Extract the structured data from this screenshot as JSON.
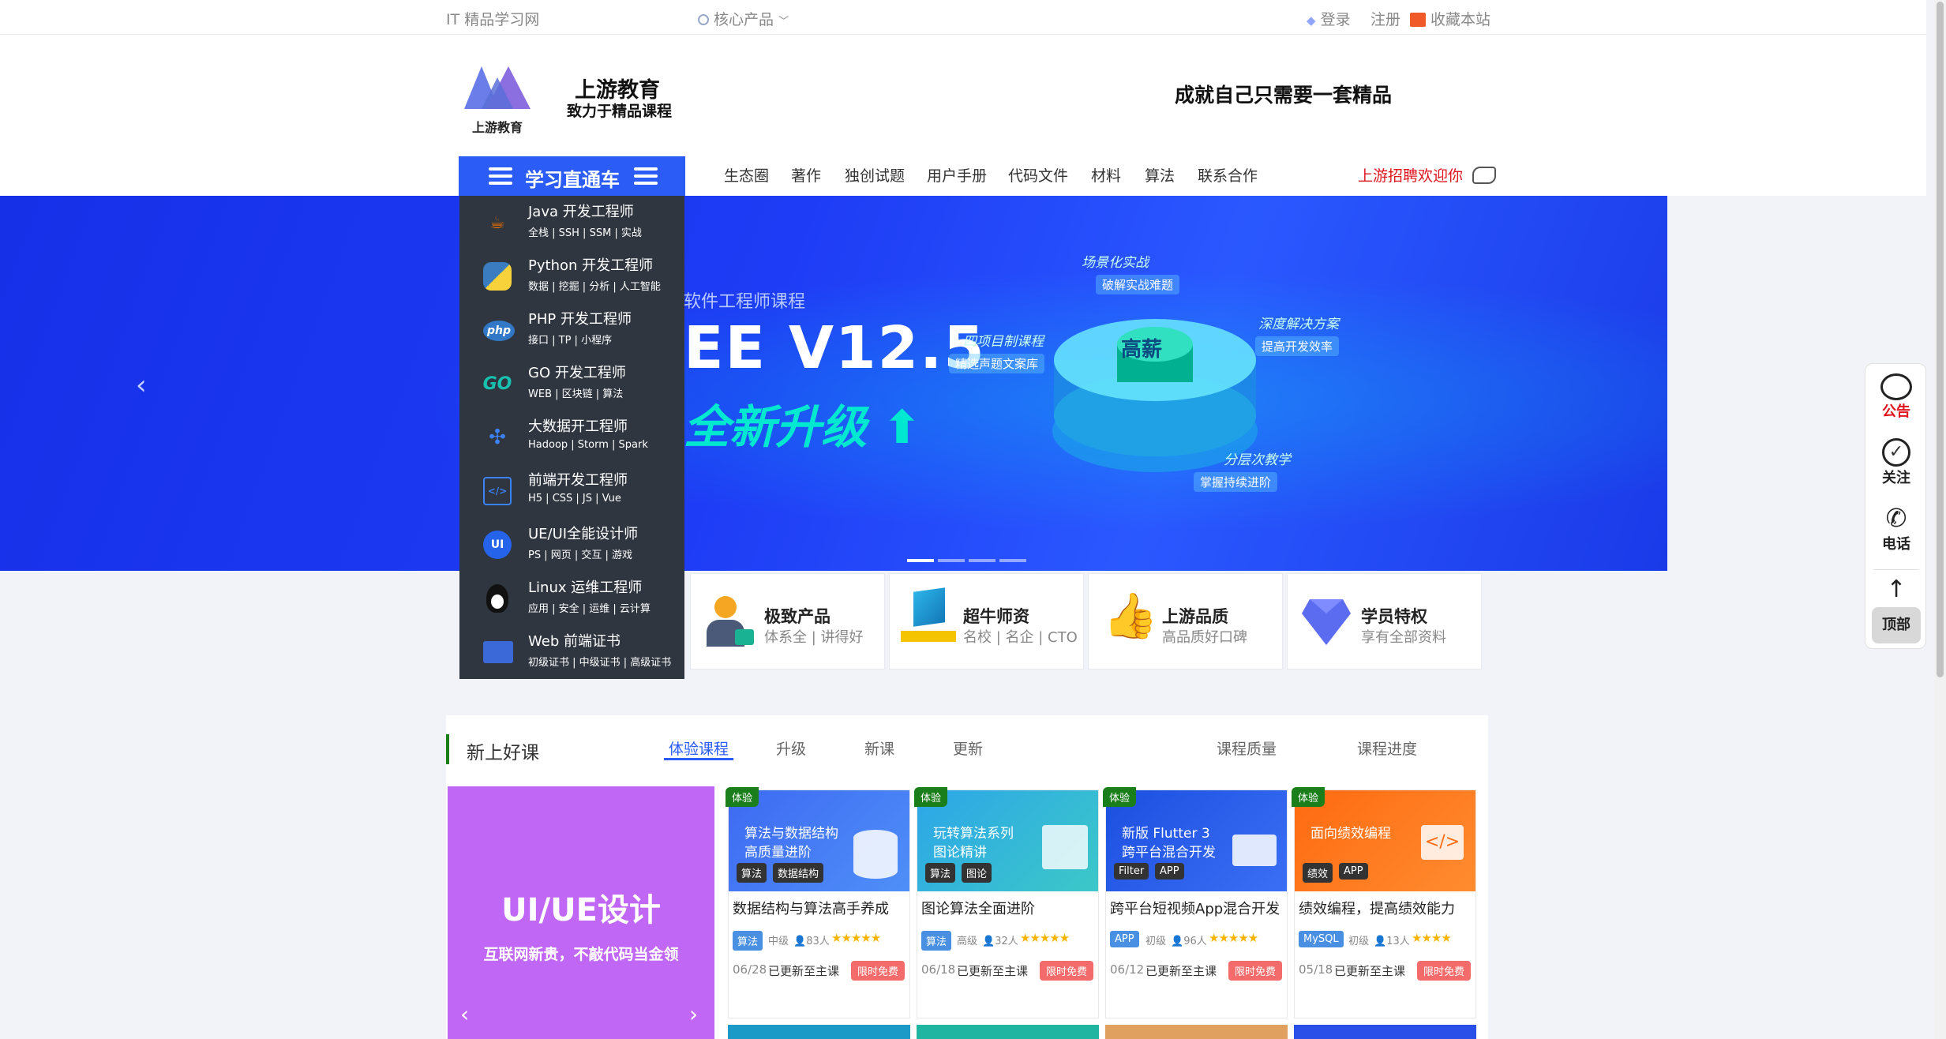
{
  "topbar": {
    "site_name": "IT 精品学习网",
    "core_products": "核心产品",
    "login": "登录",
    "register": "注册",
    "bookmark": "收藏本站"
  },
  "header": {
    "logo_caption": "上游教育",
    "brand_name": "上游教育",
    "brand_tagline": "致力于精品课程",
    "slogan": "成就自己只需要一套精品"
  },
  "nav": {
    "menu_title": "学习直通车",
    "links": [
      "生态圈",
      "著作",
      "独创试题",
      "用户手册",
      "代码文件",
      "材料",
      "算法",
      "联系合作"
    ],
    "recruit": "上游招聘欢迎你"
  },
  "side_menu": [
    {
      "title": "Java 开发工程师",
      "sub": "全栈 | SSH | SSM | 实战",
      "icon": "java-icon"
    },
    {
      "title": "Python 开发工程师",
      "sub": "数据 | 挖掘 | 分析 | 人工智能",
      "icon": "python-icon"
    },
    {
      "title": "PHP 开发工程师",
      "sub": "接口 | TP | 小程序",
      "icon": "php-icon"
    },
    {
      "title": "GO 开发工程师",
      "sub": "WEB | 区块链 | 算法",
      "icon": "go-icon"
    },
    {
      "title": "大数据开工程师",
      "sub": "Hadoop | Storm | Spark",
      "icon": "bigdata-icon"
    },
    {
      "title": "前端开发工程师",
      "sub": "H5 | CSS | JS | Vue",
      "icon": "code-window-icon"
    },
    {
      "title": "UE/UI全能设计师",
      "sub": "PS | 网页 | 交互 | 游戏",
      "icon": "ui-icon"
    },
    {
      "title": "Linux 运维工程师",
      "sub": "应用 | 安全 | 运维 | 云计算",
      "icon": "linux-penguin-icon"
    },
    {
      "title": "Web 前端证书",
      "sub": "初级证书 | 中级证书 | 高级证书",
      "icon": "certificate-icon"
    }
  ],
  "hero": {
    "course_label": "软件工程师课程",
    "version": "EE V12.5",
    "upgrade": "全新升级",
    "tags": [
      "场景化实战",
      "破解实战难题",
      "四项目制课程",
      "精选声题文案库",
      "深度解决方案",
      "提高开发效率",
      "分层次教学",
      "掌握持续进阶"
    ],
    "core_label": "高薪",
    "slide_count": 4,
    "active_slide": 1
  },
  "features": [
    {
      "title": "极致产品",
      "sub": "体系全 | 讲得好"
    },
    {
      "title": "超牛师资",
      "sub": "名校 | 名企 | CTO"
    },
    {
      "title": "上游品质",
      "sub": "高品质好口碑"
    },
    {
      "title": "学员特权",
      "sub": "享有全部资料"
    }
  ],
  "courses": {
    "section_title": "新上好课",
    "tabs": [
      "体验课程",
      "升级",
      "新课",
      "更新",
      "课程质量",
      "课程进度"
    ],
    "active_tab": "体验课程",
    "promo": {
      "title": "UI/UE设计",
      "subtitle": "互联网新贵，不敲代码当金领"
    },
    "cards": [
      {
        "badge": "体验",
        "img_line1": "算法与数据结构",
        "img_line2": "高质量进阶",
        "img_tags": [
          "算法",
          "数据结构"
        ],
        "title": "数据结构与算法高手养成",
        "category": "算法",
        "level": "中级",
        "students": "83人",
        "stars": "★★★★★",
        "date": "06/28",
        "update": "已更新至主课",
        "free": "限时免费"
      },
      {
        "badge": "体验",
        "img_line1": "玩转算法系列",
        "img_line2": "图论精讲",
        "img_tags": [
          "算法",
          "图论"
        ],
        "title": "图论算法全面进阶",
        "category": "算法",
        "level": "高级",
        "students": "32人",
        "stars": "★★★★★",
        "date": "06/18",
        "update": "已更新至主课",
        "free": "限时免费"
      },
      {
        "badge": "体验",
        "img_line1": "新版 Flutter 3",
        "img_line2": "跨平台混合开发",
        "img_tags": [
          "Filter",
          "APP"
        ],
        "title": "跨平台短视频App混合开发",
        "category": "APP",
        "level": "初级",
        "students": "96人",
        "stars": "★★★★★",
        "date": "06/12",
        "update": "已更新至主课",
        "free": "限时免费"
      },
      {
        "badge": "体验",
        "img_line1": "面向绩效编程",
        "img_line2": "",
        "img_tags": [
          "绩效",
          "APP"
        ],
        "title": "绩效编程，提高绩效能力",
        "category": "MySQL",
        "level": "初级",
        "students": "13人",
        "stars": "★★★★",
        "date": "05/18",
        "update": "已更新至主课",
        "free": "限时免费"
      }
    ]
  },
  "float_bar": {
    "notice": "公告",
    "follow": "关注",
    "phone": "电话",
    "top": "顶部"
  },
  "colors": {
    "accent_blue": "#2b5cf5",
    "nav_active": "#2b5cf5",
    "menu_bg": "#2f3640",
    "recruit_red": "#e0141e",
    "badge_green": "#1a7e1a",
    "free_red": "#f36b6b"
  }
}
